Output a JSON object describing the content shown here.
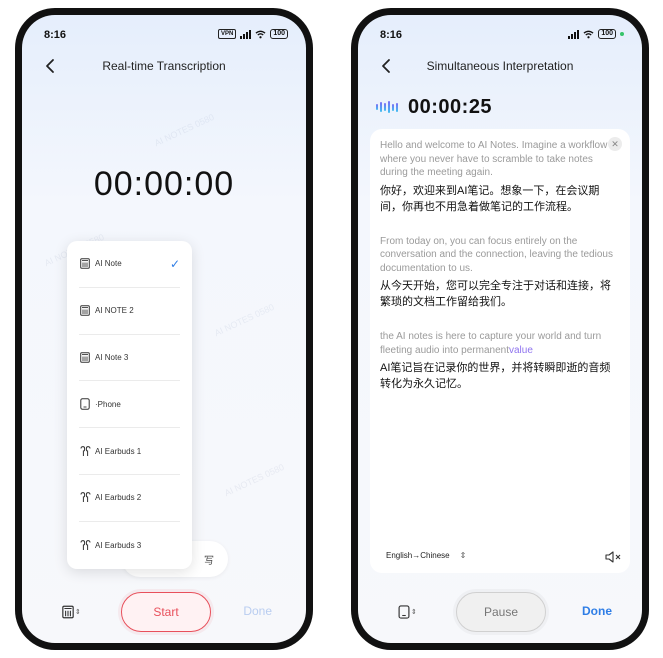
{
  "colors": {
    "accent_blue": "#2f7ee6",
    "start_red": "#e8505b",
    "highlight_purple": "#8f73ef",
    "disabled_blue": "#b9cdf0"
  },
  "left_screen": {
    "status": {
      "time": "8:16",
      "vpn": "VPN",
      "battery": "100"
    },
    "nav": {
      "title": "Real-time Transcription",
      "back_icon": "chevron-left-icon"
    },
    "timer": "00:00:00",
    "device_menu": {
      "items": [
        {
          "label": "AI Note",
          "icon": "recorder-icon",
          "selected": true
        },
        {
          "label": "AI NOTE 2",
          "icon": "recorder-icon",
          "selected": false
        },
        {
          "label": "AI Note 3",
          "icon": "recorder-icon",
          "selected": false
        },
        {
          "label": "·Phone",
          "icon": "phone-icon",
          "selected": false
        },
        {
          "label": "AI Earbuds 1",
          "icon": "earbuds-icon",
          "selected": false
        },
        {
          "label": "AI Earbuds 2",
          "icon": "earbuds-icon",
          "selected": false
        },
        {
          "label": "AI Earbuds 3",
          "icon": "earbuds-icon",
          "selected": false
        }
      ]
    },
    "pill_partial_text": "写",
    "bottom": {
      "start_label": "Start",
      "done_label": "Done"
    }
  },
  "right_screen": {
    "status": {
      "time": "8:16",
      "battery": "100"
    },
    "nav": {
      "title": "Simultaneous Interpretation",
      "back_icon": "chevron-left-icon"
    },
    "timer": "00:00:25",
    "transcript": [
      {
        "en": "Hello and welcome to AI Notes. Imagine a workflow where you never have to scramble to take notes during the meeting again.",
        "zh": "你好，欢迎来到AI笔记。想象一下，在会议期间，你再也不用急着做笔记的工作流程。"
      },
      {
        "en": "From today on, you can focus entirely on the conversation and the connection, leaving the tedious documentation to us.",
        "zh": "从今天开始，您可以完全专注于对话和连接，将繁琐的文档工作留给我们。"
      },
      {
        "en": "the AI notes is here to capture your world and turn fleeting audio into permanent",
        "en_highlight": "value",
        "zh": "AI笔记旨在记录你的世界，并将转瞬即逝的音频转化为永久记忆。"
      }
    ],
    "lang_selector": "English→Chinese",
    "bottom": {
      "pause_label": "Pause",
      "done_label": "Done"
    }
  }
}
